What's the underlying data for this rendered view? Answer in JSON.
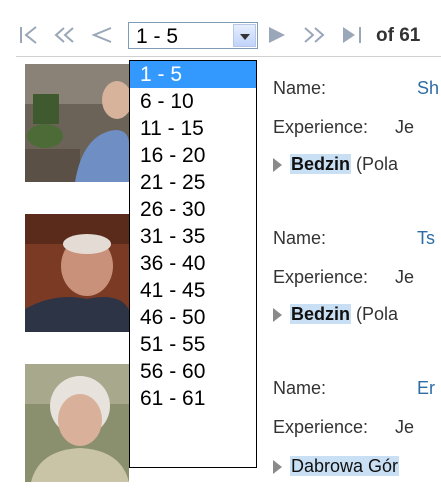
{
  "pager": {
    "selected_range": "1 - 5",
    "of_total": "of 61",
    "ranges": [
      "1 - 5",
      "6 - 10",
      "11 - 15",
      "16 - 20",
      "21 - 25",
      "26 - 30",
      "31 - 35",
      "36 - 40",
      "41 - 45",
      "46 - 50",
      "51 - 55",
      "56 - 60",
      "61 - 61"
    ],
    "accent_color": "#3399ff"
  },
  "results": [
    {
      "name_label": "Name:",
      "name_value": "Sh",
      "experience_label": "Experience:",
      "experience_value": "Je",
      "place": "Bedzin",
      "country": "(Pola"
    },
    {
      "name_label": "Name:",
      "name_value": "Ts",
      "experience_label": "Experience:",
      "experience_value": "Je",
      "place": "Bedzin",
      "country": "(Pola"
    },
    {
      "name_label": "Name:",
      "name_value": "Er",
      "experience_label": "Experience:",
      "experience_value": "Je",
      "place": "Dabrowa Gór",
      "country": ""
    }
  ]
}
